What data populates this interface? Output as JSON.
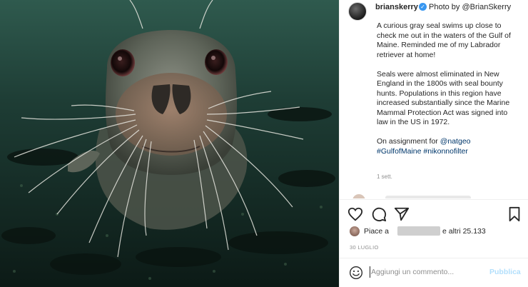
{
  "post": {
    "username": "brianskerry",
    "verified_icon": "verified-badge-icon",
    "credit": "Photo by @BrianSkerry",
    "caption": [
      "A curious gray seal swims up close to check me out in the waters of the Gulf of Maine. Reminded me of my Labrador retriever at home!",
      "Seals were almost eliminated in New England in the 1800s with seal bounty hunts. Populations in this region have increased substantially since the Marine Mammal Protection Act was signed into law in the US in 1972."
    ],
    "assignment_text": "On assignment for ",
    "assignment_mention": "@natgeo",
    "hashtags": "#GulfofMaine #nikonnofilter",
    "time_ago": "1 sett.",
    "likes_prefix": "Piace a",
    "likes_suffix": "e altri 25.133",
    "date": "30 LUGLIO"
  },
  "actions": {
    "like_icon": "heart-icon",
    "comment_icon": "comment-icon",
    "share_icon": "share-icon",
    "save_icon": "bookmark-icon"
  },
  "comment_bar": {
    "placeholder": "Aggiungi un commento...",
    "value": "",
    "emoji_icon": "smiley-icon",
    "publish_label": "Pubblica"
  },
  "colors": {
    "link": "#00376b",
    "publish_disabled": "#b2dffc",
    "water": "#1f3b34"
  }
}
